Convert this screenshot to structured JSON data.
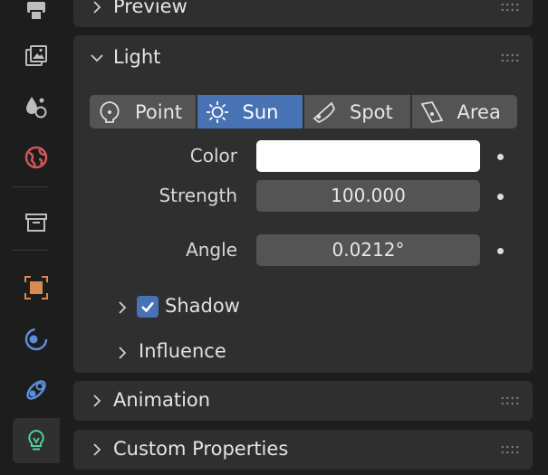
{
  "sidebar": {
    "tabs": [
      {
        "icon": "printer-icon",
        "active": false
      },
      {
        "icon": "image-stack-icon",
        "active": false
      },
      {
        "icon": "particles-icon",
        "active": false
      },
      {
        "icon": "world-icon",
        "active": false
      },
      {
        "icon": "collection-box-icon",
        "active": false
      },
      {
        "icon": "object-icon",
        "active": false
      },
      {
        "icon": "physics-icon",
        "active": false
      },
      {
        "icon": "constraints-icon",
        "active": false
      },
      {
        "icon": "light-bulb-icon",
        "active": true
      }
    ]
  },
  "panels": {
    "preview": {
      "title": "Preview",
      "expanded": false
    },
    "light": {
      "title": "Light",
      "expanded": true,
      "types": [
        {
          "label": "Point",
          "icon": "point-light-icon",
          "active": false
        },
        {
          "label": "Sun",
          "icon": "sun-light-icon",
          "active": true
        },
        {
          "label": "Spot",
          "icon": "spot-light-icon",
          "active": false
        },
        {
          "label": "Area",
          "icon": "area-light-icon",
          "active": false
        }
      ],
      "color_label": "Color",
      "color_value": "#ffffff",
      "strength_label": "Strength",
      "strength_value": "100.000",
      "angle_label": "Angle",
      "angle_value": "0.0212°",
      "shadow": {
        "label": "Shadow",
        "checked": true
      },
      "influence": {
        "label": "Influence"
      }
    },
    "animation": {
      "title": "Animation",
      "expanded": false
    },
    "custom_properties": {
      "title": "Custom Properties",
      "expanded": false
    }
  },
  "colors": {
    "accent": "#4772b3",
    "panel": "#2f2f2f",
    "field": "#545454",
    "background": "#1d1d1d"
  }
}
